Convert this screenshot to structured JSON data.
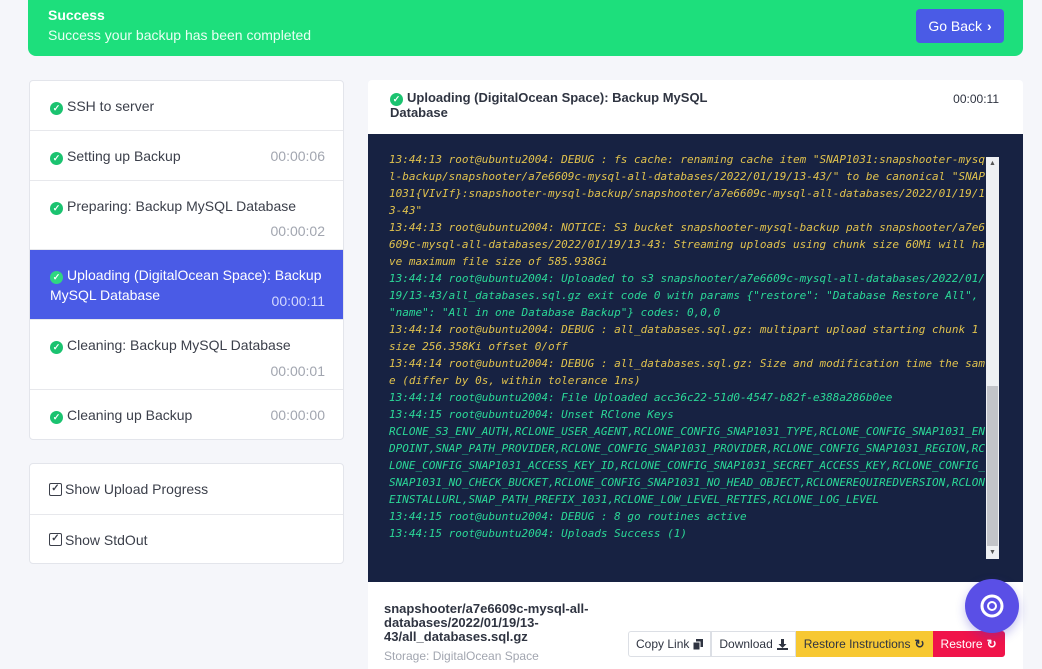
{
  "banner": {
    "title": "Success",
    "message": "Success your backup has been completed",
    "go_back": "Go Back",
    "color": "#1ddf7c"
  },
  "steps": [
    {
      "label": "SSH to server",
      "time": "",
      "done": true
    },
    {
      "label": "Setting up Backup",
      "time": "00:00:06",
      "done": true
    },
    {
      "label": "Preparing: Backup MySQL Database",
      "time": "00:00:02",
      "done": true
    },
    {
      "label": "Uploading (DigitalOcean Space): Backup MySQL Database",
      "time": "00:00:11",
      "done": true,
      "active": true
    },
    {
      "label": "Cleaning: Backup MySQL Database",
      "time": "00:00:01",
      "done": true
    },
    {
      "label": "Cleaning up Backup",
      "time": "00:00:00",
      "done": true
    }
  ],
  "options": [
    {
      "label": "Show Upload Progress",
      "checked": true
    },
    {
      "label": "Show StdOut",
      "checked": true
    }
  ],
  "panel": {
    "title": "Uploading (DigitalOcean Space): Backup MySQL Database",
    "time": "00:00:11"
  },
  "log": [
    {
      "text": "13:44:13 root@ubuntu2004: DEBUG : fs cache: renaming cache item \"SNAP1031:snapshooter-mysql-backup/snapshooter/a7e6609c-mysql-all-databases/2022/01/19/13-43/\" to be canonical \"SNAP1031{VIvIf}:snapshooter-mysql-backup/snapshooter/a7e6609c-mysql-all-databases/2022/01/19/13-43\"",
      "color": "yellow"
    },
    {
      "text": "13:44:13 root@ubuntu2004: NOTICE: S3 bucket snapshooter-mysql-backup path snapshooter/a7e6609c-mysql-all-databases/2022/01/19/13-43: Streaming uploads using chunk size 60Mi will have maximum file size of 585.938Gi",
      "color": "yellow"
    },
    {
      "text": "13:44:14 root@ubuntu2004: Uploaded to s3 snapshooter/a7e6609c-mysql-all-databases/2022/01/19/13-43/all_databases.sql.gz exit code 0 with params {\"restore\": \"Database Restore All\", \"name\": \"All in one Database Backup\"} codes: 0,0,0",
      "color": "green"
    },
    {
      "text": "13:44:14 root@ubuntu2004: DEBUG : all_databases.sql.gz: multipart upload starting chunk 1 size 256.358Ki offset 0/off",
      "color": "yellow"
    },
    {
      "text": "13:44:14 root@ubuntu2004: DEBUG : all_databases.sql.gz: Size and modification time the same (differ by 0s, within tolerance 1ns)",
      "color": "yellow"
    },
    {
      "text": "13:44:14 root@ubuntu2004: File Uploaded acc36c22-51d0-4547-b82f-e388a286b0ee",
      "color": "green"
    },
    {
      "text": "13:44:15 root@ubuntu2004: Unset RClone Keys",
      "color": "green"
    },
    {
      "text": "RCLONE_S3_ENV_AUTH,RCLONE_USER_AGENT,RCLONE_CONFIG_SNAP1031_TYPE,RCLONE_CONFIG_SNAP1031_ENDPOINT,SNAP_PATH_PROVIDER,RCLONE_CONFIG_SNAP1031_PROVIDER,RCLONE_CONFIG_SNAP1031_REGION,RCLONE_CONFIG_SNAP1031_ACCESS_KEY_ID,RCLONE_CONFIG_SNAP1031_SECRET_ACCESS_KEY,RCLONE_CONFIG_SNAP1031_NO_CHECK_BUCKET,RCLONE_CONFIG_SNAP1031_NO_HEAD_OBJECT,RCLONEREQUIREDVERSION,RCLONEINSTALLURL,SNAP_PATH_PREFIX_1031,RCLONE_LOW_LEVEL_RETIES,RCLONE_LOG_LEVEL",
      "color": "green"
    },
    {
      "text": "13:44:15 root@ubuntu2004: DEBUG : 8 go routines active",
      "color": "green"
    },
    {
      "text": "13:44:15 root@ubuntu2004: Uploads Success (1)",
      "color": "green"
    }
  ],
  "file": {
    "name": "snapshooter/a7e6609c-mysql-all-databases/2022/01/19/13-43/all_databases.sql.gz",
    "storage": "Storage: DigitalOcean Space"
  },
  "buttons": {
    "copy_link": "Copy Link",
    "download": "Download",
    "restore_instructions": "Restore Instructions",
    "restore": "Restore"
  }
}
